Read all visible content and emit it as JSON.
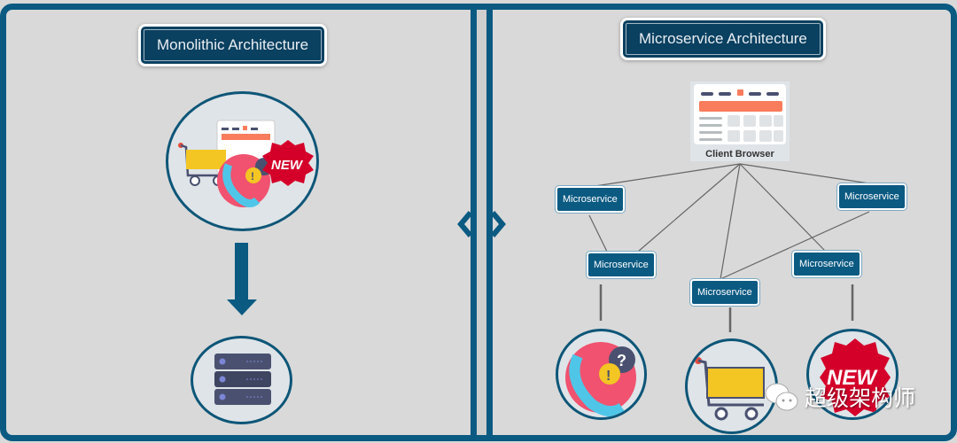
{
  "left": {
    "title": "Monolithic Architecture",
    "monolith_icons": [
      "shopping-cart-icon",
      "browser-calendar-icon",
      "support-phone-icon",
      "new-badge-icon"
    ],
    "arrow": "down-arrow-icon",
    "database": "server-stack-icon"
  },
  "right": {
    "title": "Microservice Architecture",
    "client_label": "Client Browser",
    "microservices": [
      {
        "label": "Microservice"
      },
      {
        "label": "Microservice"
      },
      {
        "label": "Microservice"
      },
      {
        "label": "Microservice"
      },
      {
        "label": "Microservice"
      }
    ],
    "service_icons": [
      "support-phone-icon",
      "shopping-cart-icon",
      "new-badge-icon"
    ],
    "new_badge_text": "NEW"
  },
  "watermark": {
    "text": "超级架构师",
    "icon": "wechat-icon"
  },
  "colors": {
    "brand": "#0b5a82",
    "title_bg": "#0a4060",
    "background": "#d9d9d9",
    "new_red": "#d4002a"
  }
}
